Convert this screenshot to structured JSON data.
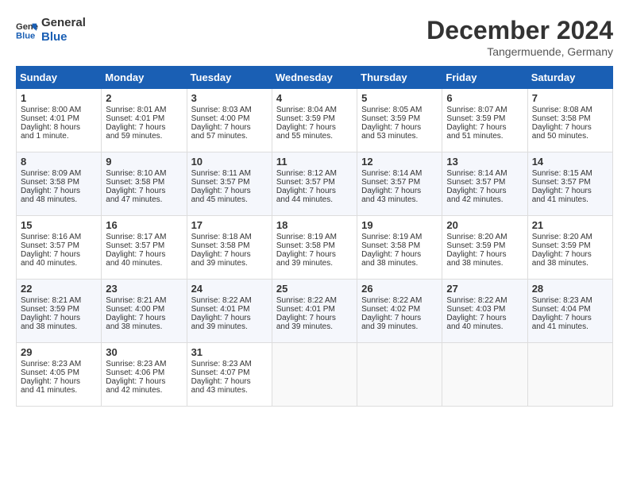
{
  "header": {
    "logo_line1": "General",
    "logo_line2": "Blue",
    "month": "December 2024",
    "location": "Tangermuende, Germany"
  },
  "weekdays": [
    "Sunday",
    "Monday",
    "Tuesday",
    "Wednesday",
    "Thursday",
    "Friday",
    "Saturday"
  ],
  "weeks": [
    [
      {
        "day": "1",
        "lines": [
          "Sunrise: 8:00 AM",
          "Sunset: 4:01 PM",
          "Daylight: 8 hours",
          "and 1 minute."
        ]
      },
      {
        "day": "2",
        "lines": [
          "Sunrise: 8:01 AM",
          "Sunset: 4:01 PM",
          "Daylight: 7 hours",
          "and 59 minutes."
        ]
      },
      {
        "day": "3",
        "lines": [
          "Sunrise: 8:03 AM",
          "Sunset: 4:00 PM",
          "Daylight: 7 hours",
          "and 57 minutes."
        ]
      },
      {
        "day": "4",
        "lines": [
          "Sunrise: 8:04 AM",
          "Sunset: 3:59 PM",
          "Daylight: 7 hours",
          "and 55 minutes."
        ]
      },
      {
        "day": "5",
        "lines": [
          "Sunrise: 8:05 AM",
          "Sunset: 3:59 PM",
          "Daylight: 7 hours",
          "and 53 minutes."
        ]
      },
      {
        "day": "6",
        "lines": [
          "Sunrise: 8:07 AM",
          "Sunset: 3:59 PM",
          "Daylight: 7 hours",
          "and 51 minutes."
        ]
      },
      {
        "day": "7",
        "lines": [
          "Sunrise: 8:08 AM",
          "Sunset: 3:58 PM",
          "Daylight: 7 hours",
          "and 50 minutes."
        ]
      }
    ],
    [
      {
        "day": "8",
        "lines": [
          "Sunrise: 8:09 AM",
          "Sunset: 3:58 PM",
          "Daylight: 7 hours",
          "and 48 minutes."
        ]
      },
      {
        "day": "9",
        "lines": [
          "Sunrise: 8:10 AM",
          "Sunset: 3:58 PM",
          "Daylight: 7 hours",
          "and 47 minutes."
        ]
      },
      {
        "day": "10",
        "lines": [
          "Sunrise: 8:11 AM",
          "Sunset: 3:57 PM",
          "Daylight: 7 hours",
          "and 45 minutes."
        ]
      },
      {
        "day": "11",
        "lines": [
          "Sunrise: 8:12 AM",
          "Sunset: 3:57 PM",
          "Daylight: 7 hours",
          "and 44 minutes."
        ]
      },
      {
        "day": "12",
        "lines": [
          "Sunrise: 8:14 AM",
          "Sunset: 3:57 PM",
          "Daylight: 7 hours",
          "and 43 minutes."
        ]
      },
      {
        "day": "13",
        "lines": [
          "Sunrise: 8:14 AM",
          "Sunset: 3:57 PM",
          "Daylight: 7 hours",
          "and 42 minutes."
        ]
      },
      {
        "day": "14",
        "lines": [
          "Sunrise: 8:15 AM",
          "Sunset: 3:57 PM",
          "Daylight: 7 hours",
          "and 41 minutes."
        ]
      }
    ],
    [
      {
        "day": "15",
        "lines": [
          "Sunrise: 8:16 AM",
          "Sunset: 3:57 PM",
          "Daylight: 7 hours",
          "and 40 minutes."
        ]
      },
      {
        "day": "16",
        "lines": [
          "Sunrise: 8:17 AM",
          "Sunset: 3:57 PM",
          "Daylight: 7 hours",
          "and 40 minutes."
        ]
      },
      {
        "day": "17",
        "lines": [
          "Sunrise: 8:18 AM",
          "Sunset: 3:58 PM",
          "Daylight: 7 hours",
          "and 39 minutes."
        ]
      },
      {
        "day": "18",
        "lines": [
          "Sunrise: 8:19 AM",
          "Sunset: 3:58 PM",
          "Daylight: 7 hours",
          "and 39 minutes."
        ]
      },
      {
        "day": "19",
        "lines": [
          "Sunrise: 8:19 AM",
          "Sunset: 3:58 PM",
          "Daylight: 7 hours",
          "and 38 minutes."
        ]
      },
      {
        "day": "20",
        "lines": [
          "Sunrise: 8:20 AM",
          "Sunset: 3:59 PM",
          "Daylight: 7 hours",
          "and 38 minutes."
        ]
      },
      {
        "day": "21",
        "lines": [
          "Sunrise: 8:20 AM",
          "Sunset: 3:59 PM",
          "Daylight: 7 hours",
          "and 38 minutes."
        ]
      }
    ],
    [
      {
        "day": "22",
        "lines": [
          "Sunrise: 8:21 AM",
          "Sunset: 3:59 PM",
          "Daylight: 7 hours",
          "and 38 minutes."
        ]
      },
      {
        "day": "23",
        "lines": [
          "Sunrise: 8:21 AM",
          "Sunset: 4:00 PM",
          "Daylight: 7 hours",
          "and 38 minutes."
        ]
      },
      {
        "day": "24",
        "lines": [
          "Sunrise: 8:22 AM",
          "Sunset: 4:01 PM",
          "Daylight: 7 hours",
          "and 39 minutes."
        ]
      },
      {
        "day": "25",
        "lines": [
          "Sunrise: 8:22 AM",
          "Sunset: 4:01 PM",
          "Daylight: 7 hours",
          "and 39 minutes."
        ]
      },
      {
        "day": "26",
        "lines": [
          "Sunrise: 8:22 AM",
          "Sunset: 4:02 PM",
          "Daylight: 7 hours",
          "and 39 minutes."
        ]
      },
      {
        "day": "27",
        "lines": [
          "Sunrise: 8:22 AM",
          "Sunset: 4:03 PM",
          "Daylight: 7 hours",
          "and 40 minutes."
        ]
      },
      {
        "day": "28",
        "lines": [
          "Sunrise: 8:23 AM",
          "Sunset: 4:04 PM",
          "Daylight: 7 hours",
          "and 41 minutes."
        ]
      }
    ],
    [
      {
        "day": "29",
        "lines": [
          "Sunrise: 8:23 AM",
          "Sunset: 4:05 PM",
          "Daylight: 7 hours",
          "and 41 minutes."
        ]
      },
      {
        "day": "30",
        "lines": [
          "Sunrise: 8:23 AM",
          "Sunset: 4:06 PM",
          "Daylight: 7 hours",
          "and 42 minutes."
        ]
      },
      {
        "day": "31",
        "lines": [
          "Sunrise: 8:23 AM",
          "Sunset: 4:07 PM",
          "Daylight: 7 hours",
          "and 43 minutes."
        ]
      },
      {
        "day": "",
        "lines": []
      },
      {
        "day": "",
        "lines": []
      },
      {
        "day": "",
        "lines": []
      },
      {
        "day": "",
        "lines": []
      }
    ]
  ]
}
